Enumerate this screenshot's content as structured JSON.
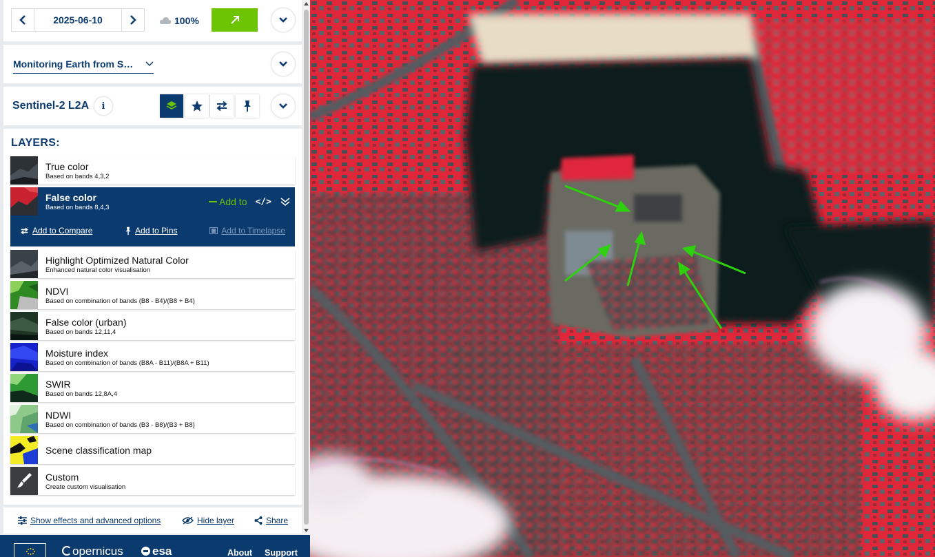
{
  "date_nav": {
    "date": "2025-06-10",
    "cloud_coverage": "100%",
    "icons": {
      "prev": "chevron-left-icon",
      "next": "chevron-right-icon",
      "cloud": "cloud-icon",
      "go": "arrow-up-right-icon",
      "collapse": "chevron-down-icon"
    }
  },
  "theme": {
    "selected": "Monitoring Earth from S…"
  },
  "collection": {
    "title": "Sentinel-2 L2A",
    "info_label": "i",
    "tools": [
      "layers-icon",
      "star-icon",
      "compare-arrows-icon",
      "pin-icon"
    ]
  },
  "layers": {
    "heading": "LAYERS:",
    "items": [
      {
        "name": "True color",
        "desc": "Based on bands 4,3,2"
      },
      {
        "name": "False color",
        "desc": "Based on bands 8,4,3"
      },
      {
        "name": "Highlight Optimized Natural Color",
        "desc": "Enhanced natural color visualisation"
      },
      {
        "name": "NDVI",
        "desc": "Based on combination of bands (B8 - B4)/(B8 + B4)"
      },
      {
        "name": "False color (urban)",
        "desc": "Based on bands 12,11,4"
      },
      {
        "name": "Moisture index",
        "desc": "Based on combination of bands (B8A - B11)/(B8A + B11)"
      },
      {
        "name": "SWIR",
        "desc": "Based on bands 12,8A,4"
      },
      {
        "name": "NDWI",
        "desc": "Based on combination of bands (B3 - B8)/(B3 + B8)"
      },
      {
        "name": "Scene classification map",
        "desc": ""
      },
      {
        "name": "Custom",
        "desc": "Create custom visualisation"
      }
    ],
    "selected_index": 1,
    "selected_actions": {
      "add_to": "Add to",
      "code_label": "</>",
      "add_to_compare": "Add to Compare",
      "add_to_pins": "Add to Pins",
      "add_to_timelapse": "Add to Timelapse"
    }
  },
  "footer_actions": {
    "effects": "Show effects and advanced options",
    "hide_layer": "Hide layer",
    "share": "Share"
  },
  "bottom_bar": {
    "copernicus": "opernicus",
    "esa": "esa",
    "about": "About",
    "support": "Support"
  },
  "colors": {
    "brand_blue": "#0b3a6e",
    "accent_green": "#6dc405",
    "annotation_arrow": "#2fd10e"
  }
}
